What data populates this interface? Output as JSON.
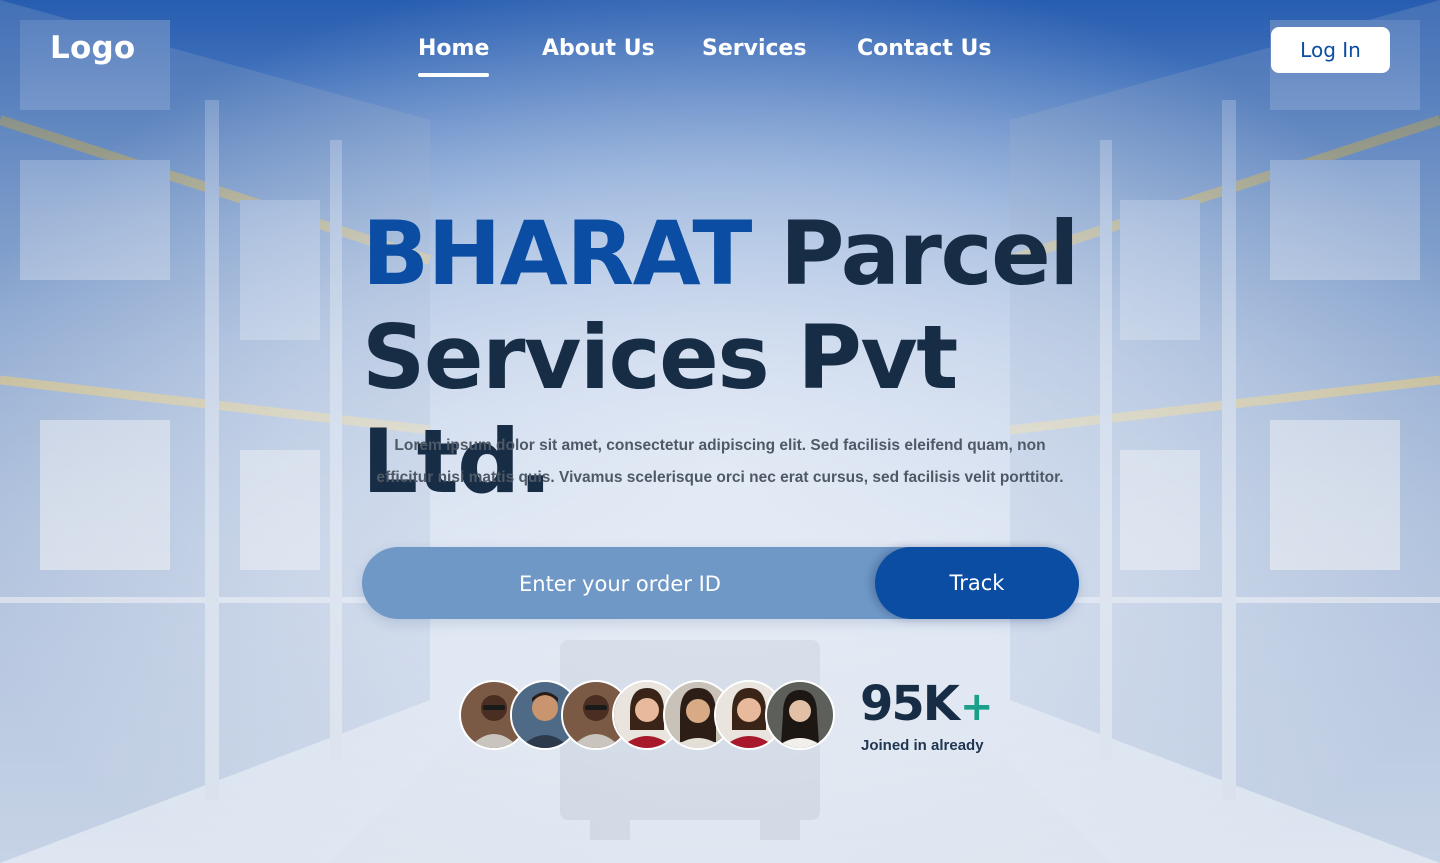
{
  "brand": {
    "logo_text": "Logo"
  },
  "nav": {
    "items": [
      {
        "label": "Home",
        "active": true
      },
      {
        "label": "About Us",
        "active": false
      },
      {
        "label": "Services",
        "active": false
      },
      {
        "label": "Contact Us",
        "active": false
      }
    ],
    "login_label": "Log In"
  },
  "hero": {
    "title_accent": "BHARAT",
    "title_rest": " Parcel Services Pvt Ltd.",
    "description": "Lorem ipsum dolor sit amet, consectetur adipiscing elit. Sed facilisis eleifend quam, non efficitur nisi mattis quis. Vivamus scelerisque orci nec erat cursus, sed facilisis velit porttitor."
  },
  "track": {
    "placeholder": "Enter your order ID",
    "value": "",
    "button_label": "Track"
  },
  "social_proof": {
    "count_number": "95K",
    "count_suffix": "+",
    "label": "Joined in already",
    "avatar_count": 7
  },
  "colors": {
    "accent": "#0a4da2",
    "heading": "#172c45",
    "plus": "#1aa08a",
    "track_bar": "#6f98c6"
  }
}
